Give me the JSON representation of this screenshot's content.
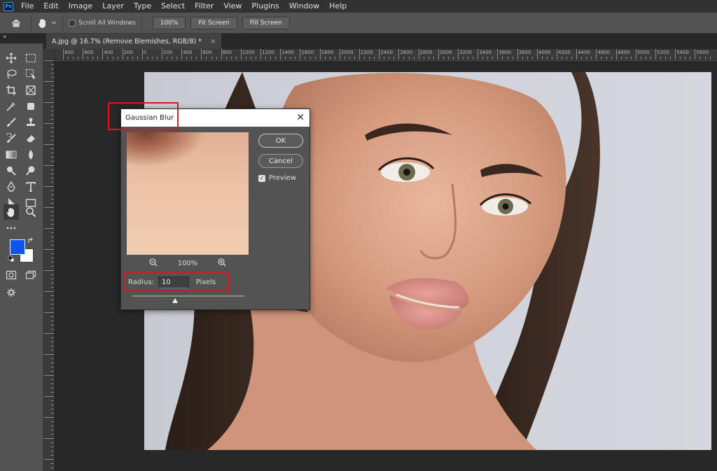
{
  "app": {
    "logo": "Ps",
    "menu": [
      "File",
      "Edit",
      "Image",
      "Layer",
      "Type",
      "Select",
      "Filter",
      "View",
      "Plugins",
      "Window",
      "Help"
    ]
  },
  "options_bar": {
    "scroll_all_windows": "Scroll All Windows",
    "zoom_100": "100%",
    "fit_screen": "Fit Screen",
    "fill_screen": "Fill Screen",
    "icons": [
      "home-icon",
      "hand-icon",
      "chevron-down-icon"
    ]
  },
  "document": {
    "tab_title": "A.jpg @ 16.7% (Remove Blemishes, RGB/8) *",
    "close": "×"
  },
  "ruler": {
    "top_labels": [
      "800",
      "600",
      "400",
      "200",
      "0",
      "200",
      "400",
      "600",
      "800",
      "1000",
      "1200",
      "1400",
      "1600",
      "1800",
      "2000",
      "2200",
      "2400",
      "2600",
      "2800",
      "3000",
      "3200",
      "3400",
      "3600",
      "3800",
      "4000",
      "4200",
      "4400",
      "4600",
      "4800",
      "5000",
      "5200",
      "5400",
      "5600"
    ]
  },
  "colors": {
    "foreground": "#0f55e8",
    "background": "#ffffff",
    "highlight": "#e0141e"
  },
  "dialog": {
    "title": "Gaussian Blur",
    "ok": "OK",
    "cancel": "Cancel",
    "preview_label": "Preview",
    "preview_checked": true,
    "zoom_level": "100%",
    "radius_label": "Radius:",
    "radius_value": "10",
    "units": "Pixels"
  }
}
